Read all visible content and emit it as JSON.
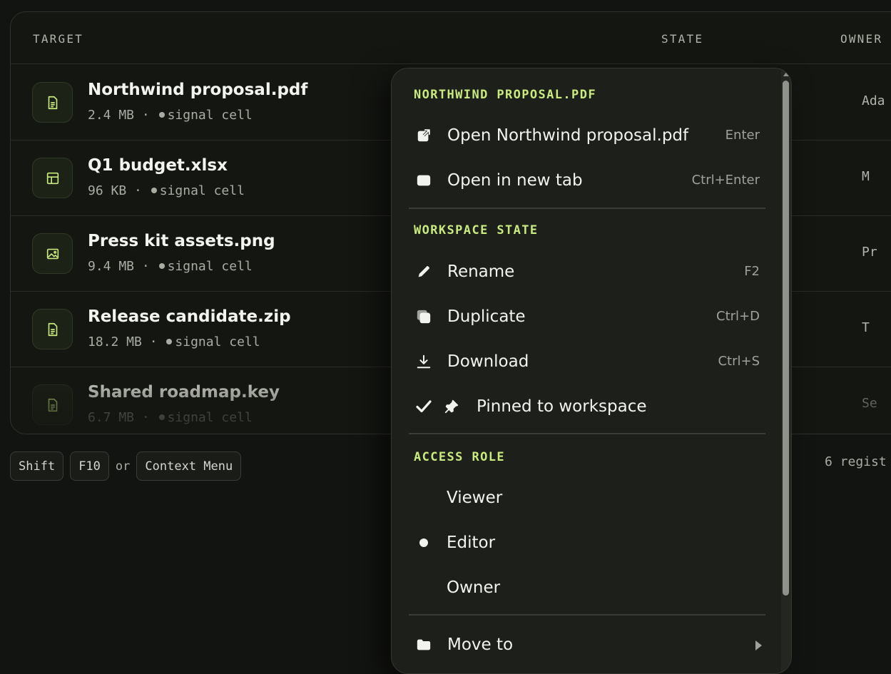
{
  "table": {
    "headers": {
      "target": "TARGET",
      "state": "STATE",
      "owner": "OWNER"
    },
    "rows": [
      {
        "name": "Northwind proposal.pdf",
        "size": "2.4 MB",
        "sep": "·",
        "status": "signal cell",
        "owner": "Ada",
        "icon": "document-icon"
      },
      {
        "name": "Q1 budget.xlsx",
        "size": "96 KB",
        "sep": "·",
        "status": "signal cell",
        "owner": "M",
        "icon": "spreadsheet-icon"
      },
      {
        "name": "Press kit assets.png",
        "size": "9.4 MB",
        "sep": "·",
        "status": "signal cell",
        "owner": "Pr",
        "icon": "image-icon"
      },
      {
        "name": "Release candidate.zip",
        "size": "18.2 MB",
        "sep": "·",
        "status": "signal cell",
        "owner": "T",
        "icon": "document-icon"
      },
      {
        "name": "Shared roadmap.key",
        "size": "6.7 MB",
        "sep": "·",
        "status": "signal cell",
        "owner": "Se",
        "icon": "document-icon"
      }
    ]
  },
  "hint": {
    "key1": "Shift",
    "key2": "F10",
    "or": "or",
    "key3": "Context Menu"
  },
  "footer": {
    "count": "6 regist"
  },
  "menu": {
    "header": "NORTHWIND PROPOSAL.PDF",
    "open": {
      "label": "Open Northwind proposal.pdf",
      "shortcut": "Enter",
      "icon": "open-external-icon"
    },
    "open_tab": {
      "label": "Open in new tab",
      "shortcut": "Ctrl+Enter",
      "icon": "tab-icon"
    },
    "section_state": "WORKSPACE STATE",
    "rename": {
      "label": "Rename",
      "shortcut": "F2",
      "icon": "pencil-icon"
    },
    "duplicate": {
      "label": "Duplicate",
      "shortcut": "Ctrl+D",
      "icon": "duplicate-icon"
    },
    "download": {
      "label": "Download",
      "shortcut": "Ctrl+S",
      "icon": "download-icon"
    },
    "pinned": {
      "label": "Pinned to workspace",
      "checked": true,
      "icon": "pin-icon"
    },
    "section_role": "ACCESS ROLE",
    "roles": [
      {
        "label": "Viewer",
        "selected": false
      },
      {
        "label": "Editor",
        "selected": true
      },
      {
        "label": "Owner",
        "selected": false
      }
    ],
    "move_to": {
      "label": "Move to",
      "icon": "folder-icon"
    }
  },
  "colors": {
    "accent": "#c9ea7e",
    "background": "#121411",
    "menu_bg": "#1d1f1b"
  }
}
